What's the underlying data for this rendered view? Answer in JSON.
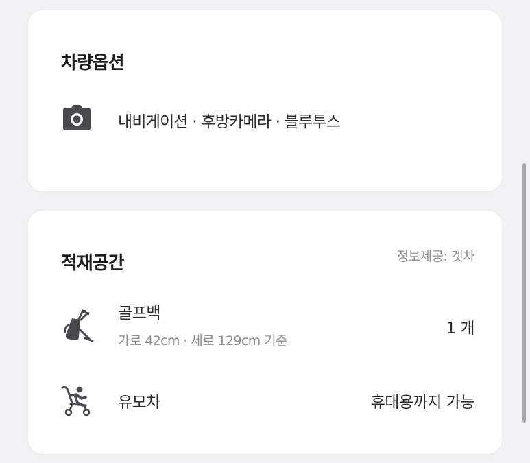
{
  "options_card": {
    "title": "차량옵션",
    "icon": "camera-icon",
    "options_text": "내비게이션 · 후방카메라 · 블루투스"
  },
  "cargo_card": {
    "title": "적재공간",
    "provider": "정보제공: 겟차",
    "items": [
      {
        "icon": "golf-bag-icon",
        "name": "골프백",
        "sub": "가로 42cm · 세로 129cm 기준",
        "value": "1 개"
      },
      {
        "icon": "stroller-icon",
        "name": "유모차",
        "value": "휴대용까지 가능"
      }
    ]
  },
  "colors": {
    "background": "#f1f1f3",
    "card": "#ffffff",
    "text_primary": "#2c2c2e",
    "text_secondary": "#8e8e93",
    "icon": "#4a4a4e"
  }
}
